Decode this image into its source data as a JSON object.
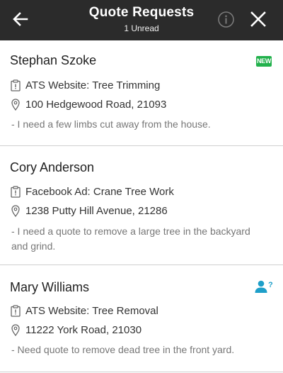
{
  "header": {
    "title": "Quote Requests",
    "subtitle": "1 Unread",
    "back_icon": "arrow-left-icon",
    "info_icon": "info-circle-icon",
    "close_icon": "close-icon"
  },
  "colors": {
    "header_bg": "#2b2b2b",
    "new_badge": "#22b14c",
    "person_icon": "#1e9fc9"
  },
  "requests": [
    {
      "name": "Stephan Szoke",
      "source": "ATS Website: Tree Trimming",
      "address": "100 Hedgewood Road, 21093",
      "note": "- I need a few limbs cut away from the house.",
      "badge": "NEW"
    },
    {
      "name": "Cory Anderson",
      "source": "Facebook Ad: Crane Tree Work",
      "address": "1238 Putty Hill Avenue, 21286",
      "note": "- I need a quote to remove a large tree in the backyard and grind."
    },
    {
      "name": "Mary Williams",
      "source": "ATS Website: Tree Removal",
      "address": "11222 York Road, 21030",
      "note": "- Need quote to remove dead tree in the front yard.",
      "status_icon": "person-question-icon"
    }
  ]
}
